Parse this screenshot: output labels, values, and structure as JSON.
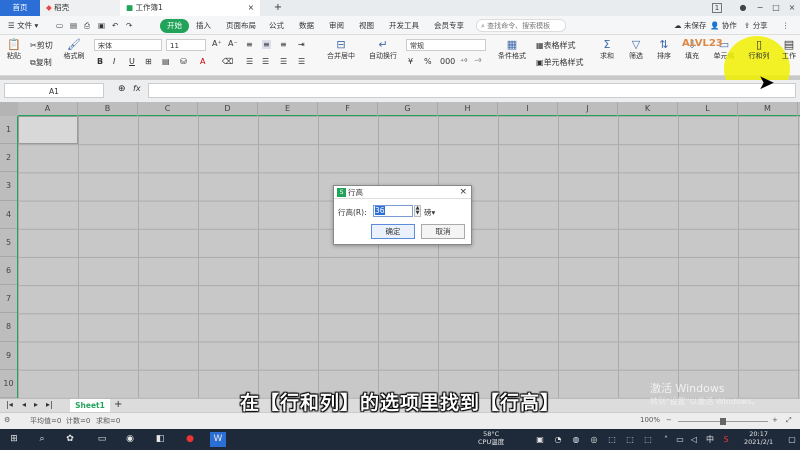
{
  "tabs": {
    "home": "首页",
    "draft": "稻壳",
    "workbook": "工作簿1",
    "add": "+",
    "badge": "1"
  },
  "menu": {
    "file": "文件",
    "items": [
      "开始",
      "插入",
      "页面布局",
      "公式",
      "数据",
      "审阅",
      "视图",
      "开发工具",
      "会员专享"
    ],
    "search": "查找命令、搜索模板",
    "unsaved": "未保存",
    "collab": "协作",
    "share": "分享"
  },
  "ribbon": {
    "paste": "粘贴",
    "cut": "剪切",
    "copy": "复制",
    "format_painter": "格式刷",
    "font": "宋体",
    "font_size": "11",
    "merge": "合并居中",
    "wrap": "自动换行",
    "number_format": "常规",
    "table_style": "表格样式",
    "cond_format": "条件格式",
    "cell_style": "单元格样式",
    "sum": "求和",
    "filter": "筛选",
    "sort": "排序",
    "fill": "填充",
    "cell": "单元格",
    "rowcol": "行和列",
    "worksheet": "工作",
    "bold": "B",
    "italic": "I",
    "underline": "U"
  },
  "formula": {
    "namebox": "A1",
    "fx": "fx"
  },
  "columns": [
    "A",
    "B",
    "C",
    "D",
    "E",
    "F",
    "G",
    "H",
    "I",
    "J",
    "K",
    "L",
    "M"
  ],
  "rows": [
    "1",
    "2",
    "3",
    "4",
    "5",
    "6",
    "7",
    "8",
    "9",
    "10"
  ],
  "dialog": {
    "title": "行高",
    "label": "行高(R):",
    "value": "36",
    "unit": "磅",
    "ok": "确定",
    "cancel": "取消"
  },
  "sheets": [
    "Sheet1"
  ],
  "status": {
    "avg": "平均值=0",
    "count": "计数=0",
    "sum": "求和=0",
    "zoom": "100%"
  },
  "subtitle": "在【行和列】的选项里找到【行高】",
  "watermark": {
    "line1": "激活 Windows",
    "line2": "转到\"设置\"以激活 Windows。"
  },
  "taskbar": {
    "temp": "58°C",
    "cpu": "CPU温度",
    "time": "20:17",
    "date": "2021/2/1",
    "ime": "中"
  },
  "logo": "ALVL23"
}
